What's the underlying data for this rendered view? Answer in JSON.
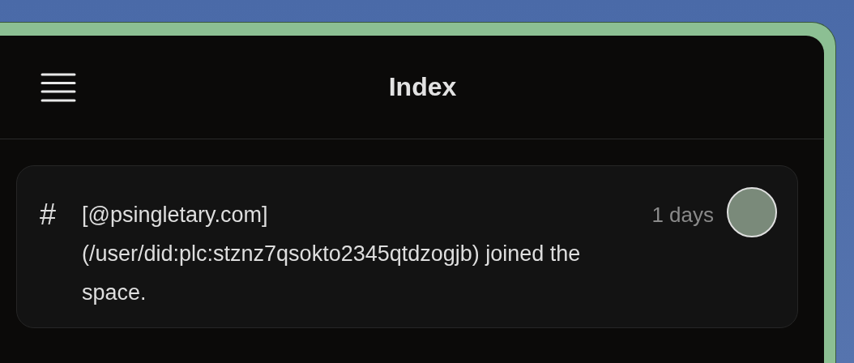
{
  "header": {
    "title": "Index"
  },
  "messages": [
    {
      "symbol": "#",
      "text": "[@psingletary.com](/user/did:plc:stznz7qsokto2345qtdzogjb) joined the space.",
      "time": "1 days"
    }
  ]
}
